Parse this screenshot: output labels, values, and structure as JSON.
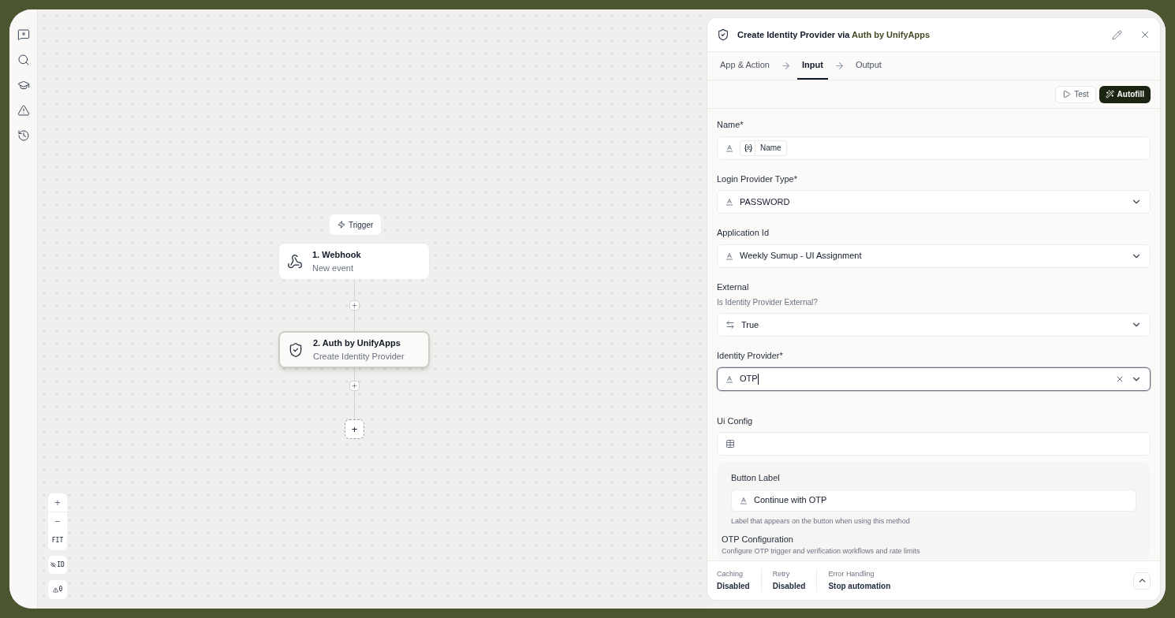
{
  "canvas": {
    "trigger_label": "Trigger",
    "nodes": [
      {
        "title": "1. Webhook",
        "subtitle": "New event",
        "selected": false
      },
      {
        "title": "2. Auth by UnifyApps",
        "subtitle": "Create Identity Provider",
        "selected": true
      }
    ],
    "add_step": "+",
    "controls": {
      "zoom_in": "+",
      "zoom_out": "−",
      "fit": "FIT",
      "id_toggle": "ID",
      "warnings": "0"
    }
  },
  "panel": {
    "title_prefix": "Create Identity Provider via",
    "title_app": "Auth by UnifyApps",
    "tabs": [
      {
        "label": "App & Action",
        "selected": false
      },
      {
        "label": "Input",
        "selected": true
      },
      {
        "label": "Output",
        "selected": false
      }
    ],
    "buttons": {
      "test": "Test",
      "autofill": "Autofill"
    },
    "fields": [
      {
        "label": "Name*",
        "kind": "token",
        "value": "Name",
        "focused": false
      },
      {
        "label": "Login Provider Type*",
        "kind": "select",
        "value": "PASSWORD",
        "focused": false
      },
      {
        "label": "Application Id",
        "kind": "select",
        "value": "Weekly Sumup - UI Assignment",
        "focused": false
      },
      {
        "label": "External",
        "description": "Is Identity Provider External?",
        "kind": "boolean",
        "value": "True",
        "focused": false
      },
      {
        "label": "Identity Provider*",
        "kind": "select",
        "value": "OTP",
        "focused": true
      },
      {
        "label": "Ui Config",
        "kind": "table",
        "focused": false
      }
    ],
    "ui_config": {
      "label": "Button Label",
      "value": "Continue with OTP",
      "help": "Label that appears on the button when using this method",
      "section_title": "OTP Configuration",
      "section_description": "Configure OTP trigger and verification workflows and rate limits"
    },
    "footer": [
      {
        "label": "Caching",
        "value": "Disabled"
      },
      {
        "label": "Retry",
        "value": "Disabled"
      },
      {
        "label": "Error Handling",
        "value": "Stop automation"
      }
    ]
  }
}
